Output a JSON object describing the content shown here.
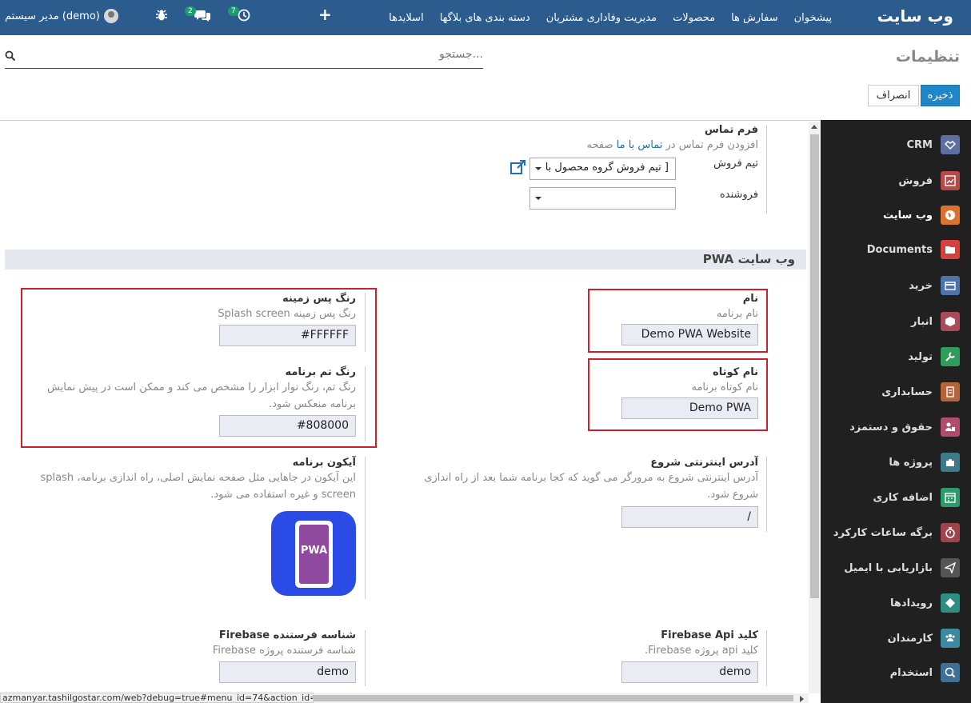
{
  "navbar": {
    "brand": "وب سایت",
    "menu": [
      "پیشخوان",
      "سفارش ها",
      "محصولات",
      "مدیریت وفاداری مشتریان",
      "دسته بندی های بلاگها",
      "اسلایدها"
    ],
    "plus": "+",
    "activities_count": "7",
    "messages_count": "2",
    "user": "مدیر سیستم (demo)"
  },
  "control": {
    "title": "تنظیمات",
    "search_placeholder": "جستجو...",
    "save_label": "ذخیره",
    "cancel_label": "انصراف"
  },
  "sidebar": {
    "items": [
      {
        "label": "CRM",
        "icon": "handshake-icon",
        "color": "#5f6ea0"
      },
      {
        "label": "فروش",
        "icon": "chart-icon",
        "color": "#b44a4a"
      },
      {
        "label": "وب سایت",
        "icon": "globe-icon",
        "color": "#d9732d",
        "active": true
      },
      {
        "label": "Documents",
        "icon": "folder-icon",
        "color": "#d34141"
      },
      {
        "label": "خرید",
        "icon": "card-icon",
        "color": "#4d73a8"
      },
      {
        "label": "انبار",
        "icon": "box-icon",
        "color": "#a84a58"
      },
      {
        "label": "تولید",
        "icon": "wrench-icon",
        "color": "#2f9c5a"
      },
      {
        "label": "حسابداری",
        "icon": "invoice-icon",
        "color": "#b6643c"
      },
      {
        "label": "حقوق و دستمزد",
        "icon": "payroll-icon",
        "color": "#b14d6b"
      },
      {
        "label": "پروژه ها",
        "icon": "puzzle-icon",
        "color": "#3c7a8a"
      },
      {
        "label": "اضافه کاری",
        "icon": "calendar-icon",
        "color": "#2e9a6c"
      },
      {
        "label": "برگه ساعات کارکرد",
        "icon": "timer-icon",
        "color": "#a0434f"
      },
      {
        "label": "بازاریابی با ایمیل",
        "icon": "paper-plane-icon",
        "color": "#555555"
      },
      {
        "label": "رویدادها",
        "icon": "ticket-icon",
        "color": "#2d8e83"
      },
      {
        "label": "کارمندان",
        "icon": "people-icon",
        "color": "#3d8aa0"
      },
      {
        "label": "استخدام",
        "icon": "search-person-icon",
        "color": "#3e6f94"
      }
    ]
  },
  "contact": {
    "title": "فرم تماس",
    "desc_before": "افزودن فرم تماس در",
    "desc_link": "تماس با ما",
    "desc_after": "صفحه",
    "team_label": "تیم فروش",
    "team_value": "[ تیم فروش گروه محصول با",
    "salesperson_label": "فروشنده"
  },
  "pwa": {
    "section_title": "PWA وب سایت",
    "name_label": "نام",
    "name_desc": "نام برنامه",
    "name_value": "Demo PWA Website",
    "short_label": "نام کوتاه",
    "short_desc": "نام کوتاه برنامه",
    "short_value": "Demo PWA",
    "bg_label": "رنگ پس زمینه",
    "bg_desc": "رنگ پس زمینه Splash screen",
    "bg_value": "#FFFFFF",
    "theme_label": "رنگ تم برنامه",
    "theme_desc": "رنگ تم، رنگ نوار ابزار را مشخص می کند و ممکن است در پیش نمایش برنامه منعکس شود.",
    "theme_value": "#808000",
    "start_label": "آدرس اینترنتی شروع",
    "start_desc": "آدرس اینترنتی شروع به مرورگر می گوید که کجا برنامه شما بعد از راه اندازی شروع شود.",
    "start_value": "/",
    "icon_label": "آیکون برنامه",
    "icon_desc": "این آیکون در جاهایی مثل صفحه نمایش اصلی، راه اندازی برنامه، splash screen و غیره استفاده می شود.",
    "icon_text": "PWA",
    "firebase_key_label": "کلید Firebase Api",
    "firebase_key_desc": "کلید api پروژه Firebase.",
    "firebase_key_value": "demo",
    "firebase_sender_label": "شناسه فرستنده Firebase",
    "firebase_sender_desc": "شناسه فرستنده پروژه Firebase",
    "firebase_sender_value": "demo"
  },
  "status_url": "azmanyar.tashilgostar.com/web?debug=true#menu_id=74&action_id=91"
}
